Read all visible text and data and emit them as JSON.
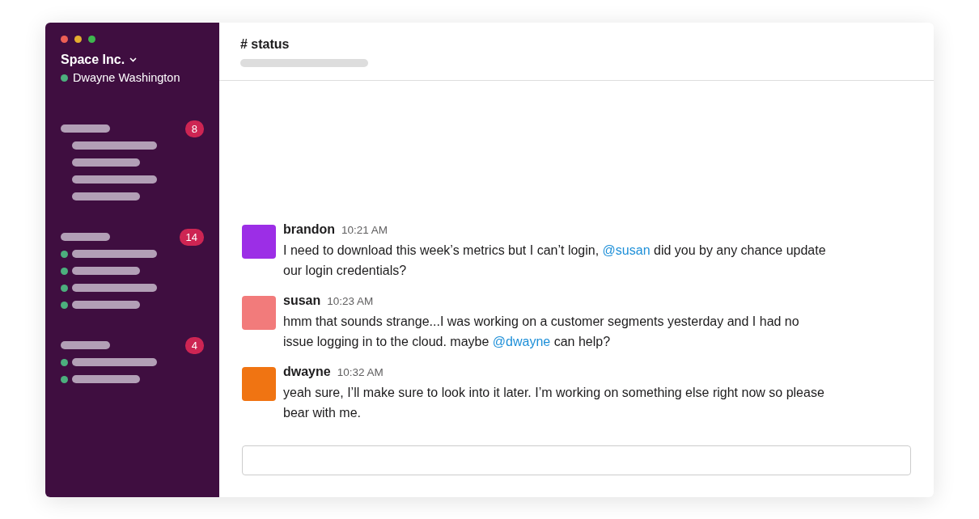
{
  "window": {
    "controls": [
      {
        "kind": "close"
      },
      {
        "kind": "minimize"
      },
      {
        "kind": "zoom"
      }
    ]
  },
  "workspace": {
    "name": "Space Inc.",
    "user": "Dwayne Washington",
    "online": true
  },
  "sidebar": {
    "sections": [
      {
        "badge": "8",
        "items": [
          {
            "online": false
          },
          {
            "online": false
          },
          {
            "online": false
          },
          {
            "online": false
          }
        ]
      },
      {
        "badge": "14",
        "items": [
          {
            "online": true
          },
          {
            "online": true
          },
          {
            "online": true
          },
          {
            "online": true
          }
        ]
      },
      {
        "badge": "4",
        "items": [
          {
            "online": true
          },
          {
            "online": true
          }
        ]
      }
    ]
  },
  "channel": {
    "title": "# status"
  },
  "messages": [
    {
      "author": "brandon",
      "time": "10:21 AM",
      "color": "#9c2ee6",
      "parts": [
        {
          "kind": "text",
          "text": "I need to download this week’s metrics but I can’t login, "
        },
        {
          "kind": "mention",
          "text": "@susan"
        },
        {
          "kind": "text",
          "text": " did you by any chance update our login credentials?"
        }
      ]
    },
    {
      "author": "susan",
      "time": "10:23 AM",
      "color": "#f27b7b",
      "parts": [
        {
          "kind": "text",
          "text": "hmm that sounds strange...I was working on a customer segments yesterday and I had no issue logging in to the cloud. maybe "
        },
        {
          "kind": "mention",
          "text": "@dwayne"
        },
        {
          "kind": "text",
          "text": " can help?"
        }
      ]
    },
    {
      "author": "dwayne",
      "time": "10:32 AM",
      "color": "#f07412",
      "parts": [
        {
          "kind": "text",
          "text": "yeah sure, I’ll make sure to look into it later. I’m working on something else right now so please bear with me."
        }
      ]
    }
  ]
}
